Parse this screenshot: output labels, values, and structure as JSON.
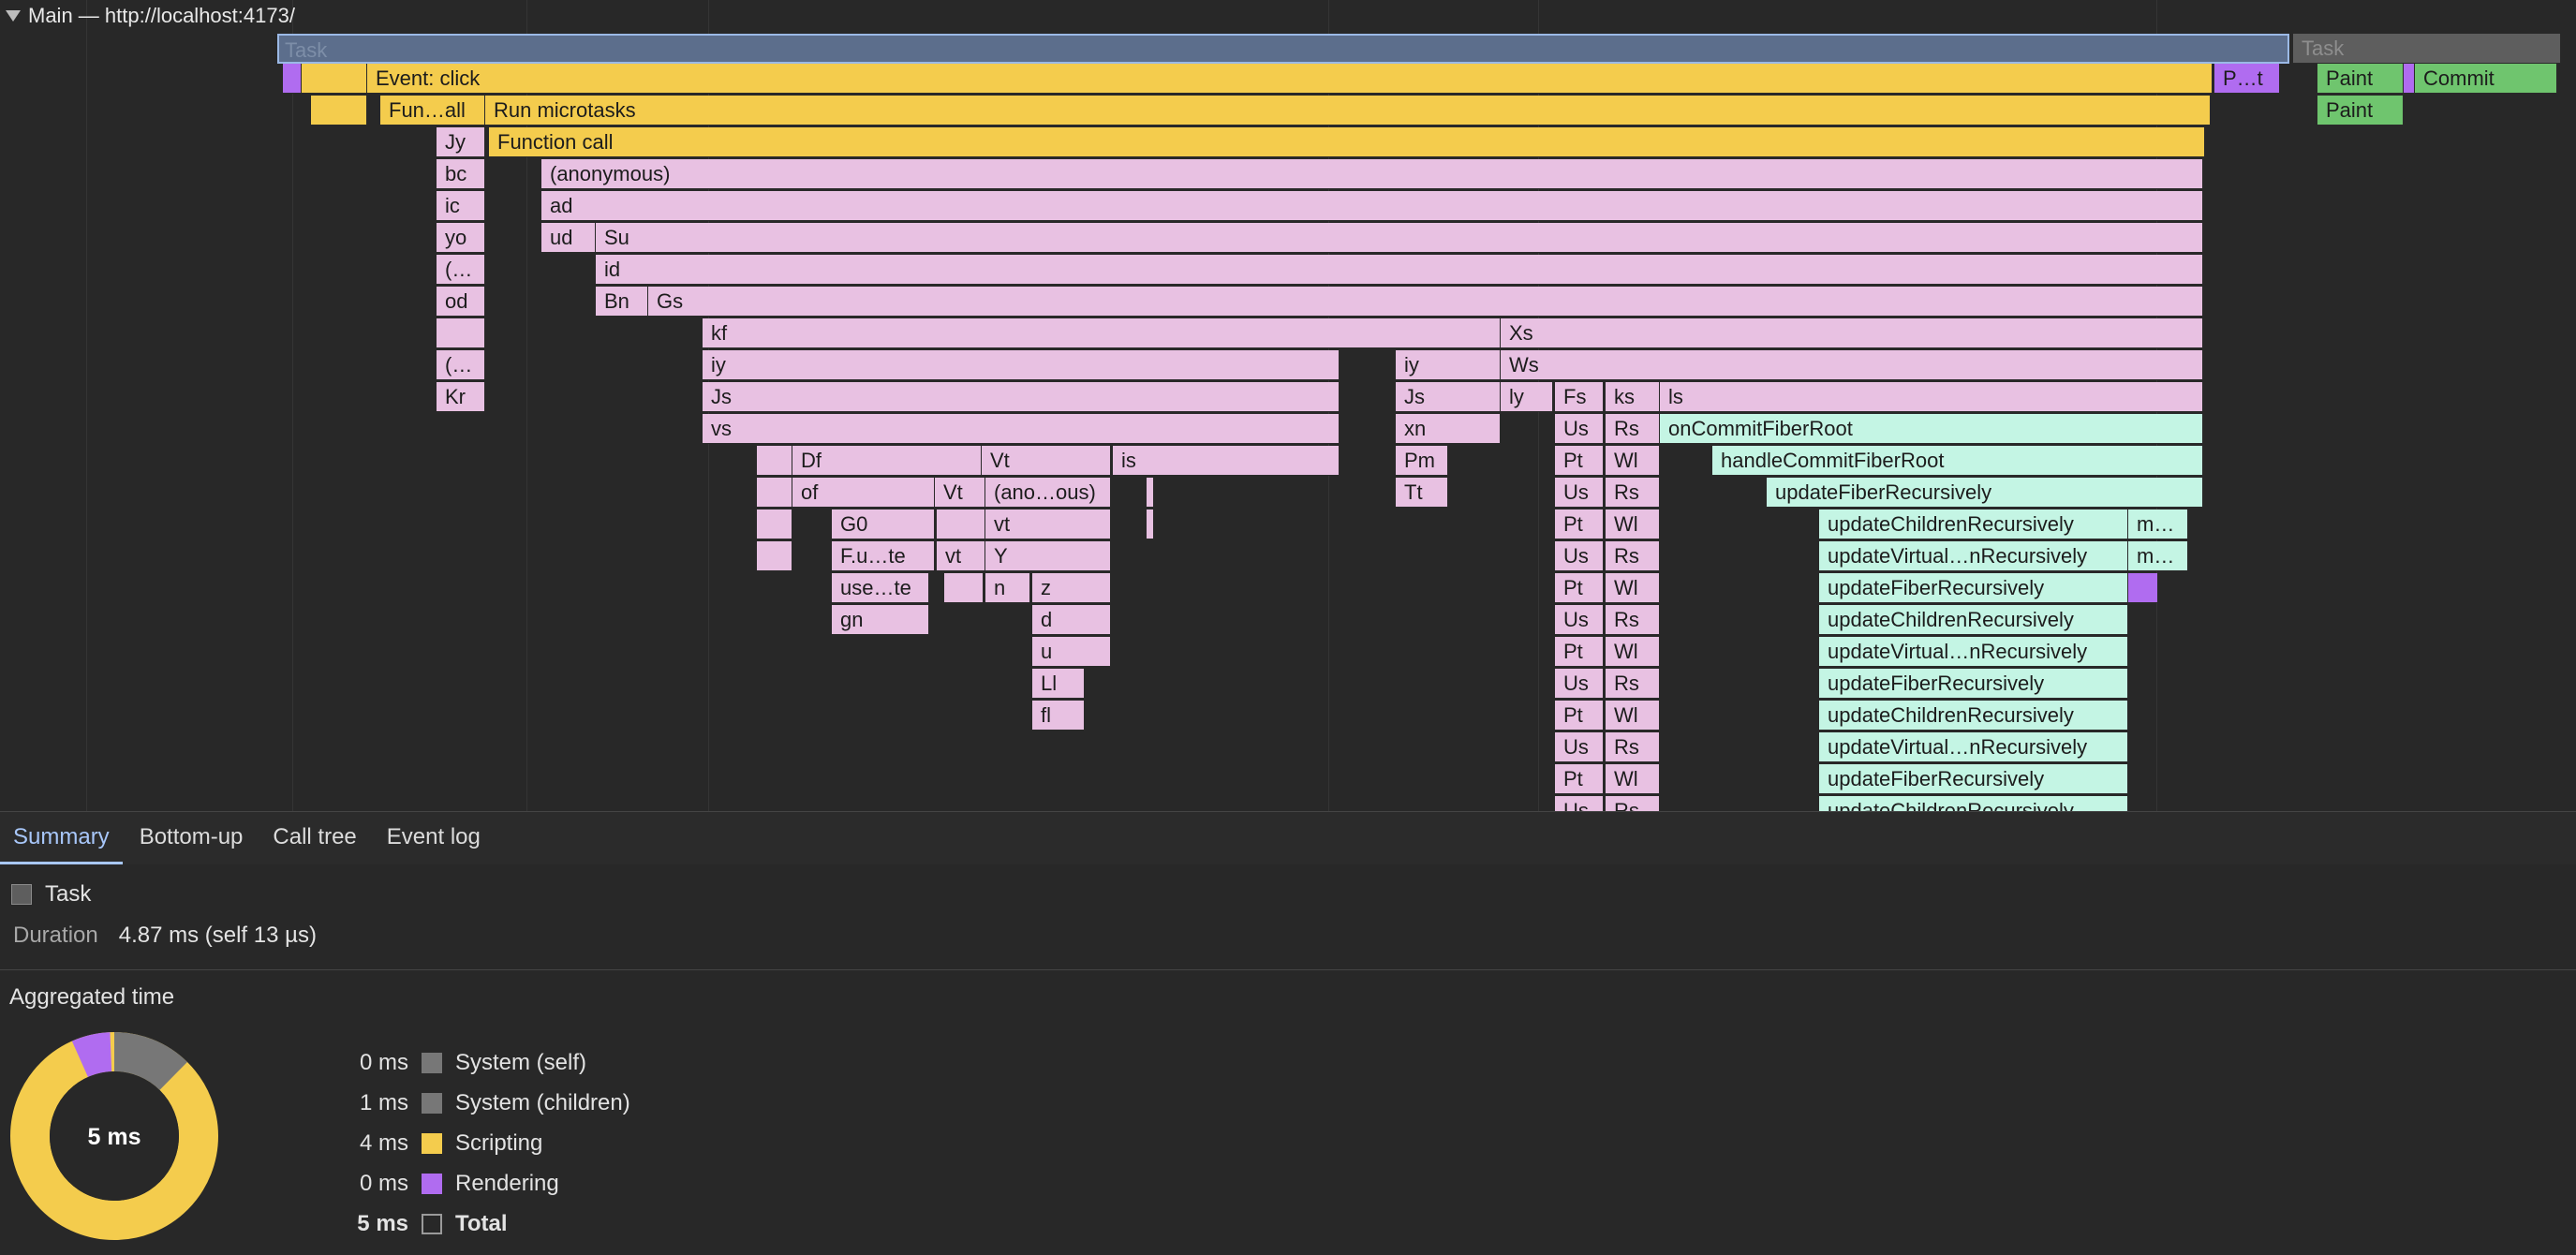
{
  "track": {
    "title": "Main — http://localhost:4173/"
  },
  "flame": {
    "task1": "Task",
    "task2": "Task",
    "event_click": "Event: click",
    "paint_t": "P…t",
    "paint_a": "Paint",
    "commit": "Commit",
    "paint_b": "Paint",
    "fun_all": "Fun…all",
    "run_microtasks": "Run microtasks",
    "jy": "Jy",
    "function_call": "Function call",
    "bc": "bc",
    "anonymous": "(anonymous)",
    "ic": "ic",
    "ad": "ad",
    "yo": "yo",
    "ud": "ud",
    "su": "Su",
    "paren1": "(…",
    "id": "id",
    "od": "od",
    "bn": "Bn",
    "gs": "Gs",
    "kf": "kf",
    "xs": "Xs",
    "paren2": "(…",
    "iy1": "iy",
    "iy2": "iy",
    "ws": "Ws",
    "kr": "Kr",
    "js1": "Js",
    "js2": "Js",
    "ly": "ly",
    "fs": "Fs",
    "ks": "ks",
    "ls": "ls",
    "vs": "vs",
    "xn": "xn",
    "us1": "Us",
    "rs1": "Rs",
    "on_commit": "onCommitFiberRoot",
    "df": "Df",
    "vt1": "Vt",
    "is": "is",
    "pm": "Pm",
    "pt1": "Pt",
    "wl1": "Wl",
    "handle_commit": "handleCommitFiberRoot",
    "of": "of",
    "vt2": "Vt",
    "anoous": "(ano…ous)",
    "tt": "Tt",
    "us2": "Us",
    "rs2": "Rs",
    "update_fiber": "updateFiberRecursively",
    "g0": "G0",
    "vt_lower": "vt",
    "pt2": "Pt",
    "wl2": "Wl",
    "m1": "m…",
    "fute": "F.u…te",
    "vt3": "vt",
    "y_": "Y",
    "us3": "Us",
    "rs3": "Rs",
    "m2": "m…",
    "usete": "use…te",
    "n": "n",
    "z": "z",
    "pt3": "Pt",
    "wl3": "Wl",
    "gn": "gn",
    "d": "d",
    "us4": "Us",
    "rs4": "Rs",
    "u": "u",
    "pt4": "Pt",
    "wl4": "Wl",
    "ll": "Ll",
    "us5": "Us",
    "rs5": "Rs",
    "fl": "fl",
    "pt5": "Pt",
    "wl5": "Wl",
    "us6": "Us",
    "rs6": "Rs",
    "pt6": "Pt",
    "wl6": "Wl",
    "us7": "Us",
    "rs7": "Rs",
    "upd_children": "updateChildrenRecursively",
    "upd_virtual": "updateVirtual…nRecursively",
    "upd_fiber": "updateFiberRecursively"
  },
  "tabs": [
    "Summary",
    "Bottom-up",
    "Call tree",
    "Event log"
  ],
  "summary": {
    "selected_name": "Task",
    "duration_label": "Duration",
    "duration_value": "4.87 ms (self 13 µs)",
    "aggregated_title": "Aggregated time",
    "total_center": "5 ms",
    "legend": [
      {
        "value": "0 ms",
        "label": "System (self)",
        "color": "#777777"
      },
      {
        "value": "1 ms",
        "label": "System (children)",
        "color": "#777777"
      },
      {
        "value": "4 ms",
        "label": "Scripting",
        "color": "#f4cc4d"
      },
      {
        "value": "0 ms",
        "label": "Rendering",
        "color": "#b06cf0"
      },
      {
        "value": "5 ms",
        "label": "Total",
        "color": "transparent"
      }
    ]
  },
  "colors": {
    "scripting": "#f4cc4d",
    "function": "#e8c1e2",
    "react": "#c4f5e4",
    "paint": "#6fc56e",
    "rendering": "#b06cf0",
    "system": "#777777",
    "accent": "#a8c7fa"
  }
}
